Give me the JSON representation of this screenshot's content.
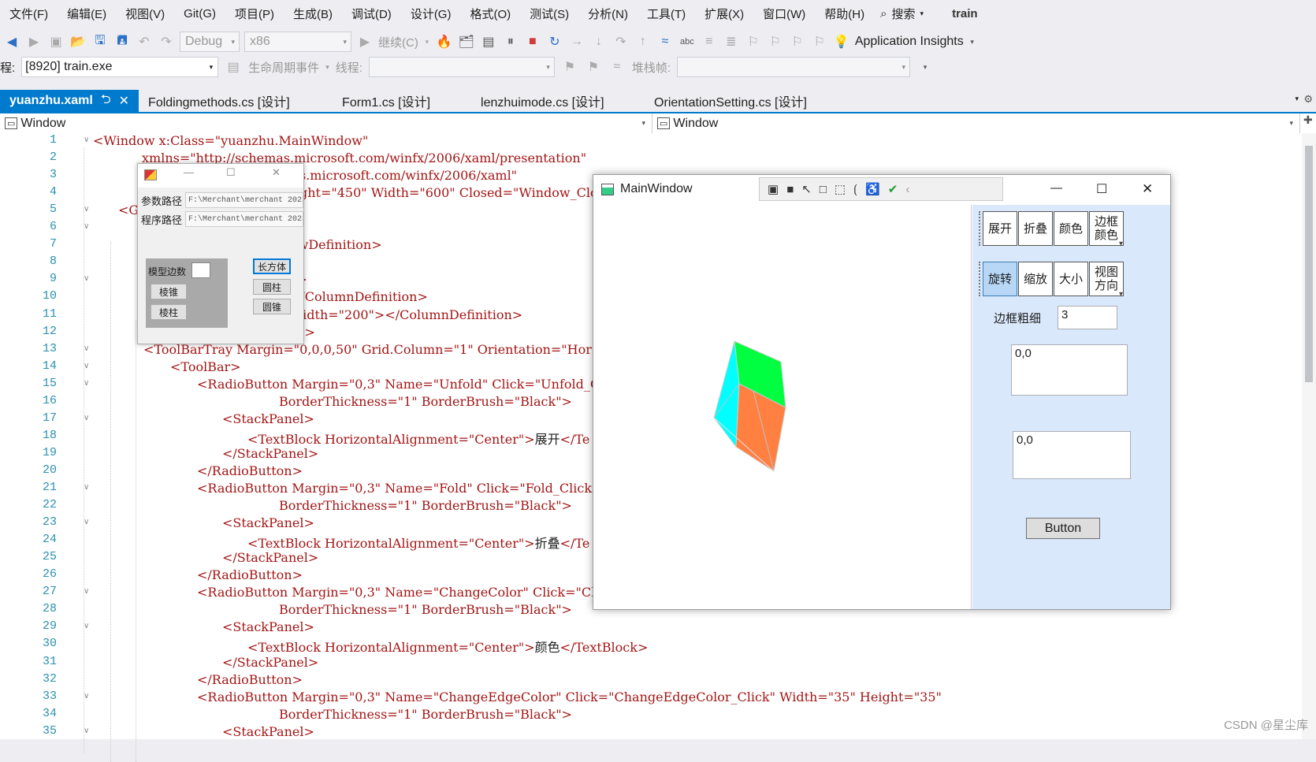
{
  "menu": [
    "文件(F)",
    "编辑(E)",
    "视图(V)",
    "Git(G)",
    "项目(P)",
    "生成(B)",
    "调试(D)",
    "设计(G)",
    "格式(O)",
    "测试(S)",
    "分析(N)",
    "工具(T)",
    "扩展(X)",
    "窗口(W)",
    "帮助(H)"
  ],
  "search_label": "搜索",
  "project_name": "train",
  "toolbar": {
    "config": "Debug",
    "platform": "x86",
    "continue_label": "继续(C)",
    "app_insights": "Application Insights"
  },
  "debug_bar": {
    "process_prefix": "程:",
    "process": "[8920] train.exe",
    "lifecycle": "生命周期事件",
    "thread_label": "线程:",
    "stack_label": "堆栈帧:"
  },
  "tabs": [
    {
      "label": "yuanzhu.xaml",
      "active": true
    },
    {
      "label": "Foldingmethods.cs [设计]",
      "active": false
    },
    {
      "label": "Form1.cs [设计]",
      "active": false
    },
    {
      "label": "lenzhuimode.cs [设计]",
      "active": false
    },
    {
      "label": "OrientationSetting.cs [设计]",
      "active": false
    }
  ],
  "nav": {
    "left": "Window",
    "right": "Window"
  },
  "line_numbers": [
    "1",
    "2",
    "3",
    "4",
    "5",
    "6",
    "7",
    "8",
    "9",
    "10",
    "11",
    "12",
    "13",
    "14",
    "15",
    "16",
    "17",
    "18",
    "19",
    "20",
    "21",
    "22",
    "23",
    "24",
    "25",
    "26",
    "27",
    "28",
    "29",
    "30",
    "31",
    "32",
    "33",
    "34",
    "35"
  ],
  "code": {
    "l1": "<Window x:Class=\"yuanzhu.MainWindow\"",
    "l2": "xmlns=\"http://schemas.microsoft.com/winfx/2006/xaml/presentation\"",
    "l3": "s.microsoft.com/winfx/2006/xaml\"",
    "l4": "ght=\"450\" Width=\"600\" Closed=\"Window_Clos",
    "l5": "<G",
    "l7": "owDefinition>",
    "l9": "s>",
    "l10": "</ColumnDefinition>",
    "l11": "Width=\"200\"></ColumnDefinition>",
    "l12": "ns>",
    "l13": "<ToolBarTray Margin=\"0,0,0,50\" Grid.Column=\"1\" Orientation=\"Hor",
    "l14": "<ToolBar>",
    "l15": "<RadioButton Margin=\"0,3\" Name=\"Unfold\" Click=\"Unfold_Cl",
    "l16": "BorderThickness=\"1\" BorderBrush=\"Black\">",
    "l17": "<StackPanel>",
    "l18a": "<TextBlock HorizontalAlignment=\"Center\">",
    "l18b": "展开",
    "l18c": "</Te",
    "l19": "</StackPanel>",
    "l20": "</RadioButton>",
    "l21": "<RadioButton Margin=\"0,3\" Name=\"Fold\" Click=\"Fold_Click\"",
    "l22": "BorderThickness=\"1\" BorderBrush=\"Black\">",
    "l23": "<StackPanel>",
    "l24a": "<TextBlock HorizontalAlignment=\"Center\">",
    "l24b": "折叠",
    "l24c": "</Te",
    "l25": "</StackPanel>",
    "l26": "</RadioButton>",
    "l27": "<RadioButton Margin=\"0,3\" Name=\"ChangeColor\" Click=\"Cha",
    "l28": "BorderThickness=\"1\" BorderBrush=\"Black\">",
    "l29": "<StackPanel>",
    "l30a": "<TextBlock HorizontalAlignment=\"Center\">",
    "l30b": "颜色",
    "l30c": "</TextBlock>",
    "l31": "</StackPanel>",
    "l32": "</RadioButton>",
    "l33": "<RadioButton Margin=\"0,3\" Name=\"ChangeEdgeColor\" Click=\"ChangeEdgeColor_Click\" Width=\"35\" Height=\"35\"",
    "l34": "BorderThickness=\"1\" BorderBrush=\"Black\">",
    "l35": "<StackPanel>"
  },
  "winform": {
    "param_label": "参数路径",
    "param_value": "F:\\Merchant\\merchant 2023",
    "program_label": "程序路径",
    "program_value": "F:\\Merchant\\merchant 2023",
    "edges_label": "模型边数",
    "btn_cone": "棱锥",
    "btn_prism": "棱柱",
    "btn_cuboid": "长方体",
    "btn_cylinder": "圆柱",
    "btn_circlecone": "圆锥"
  },
  "wpf": {
    "title": "MainWindow",
    "group1": [
      "展开",
      "折叠",
      "颜色",
      "边框颜色"
    ],
    "group2": [
      "旋转",
      "缩放",
      "大小",
      "视图方向"
    ],
    "border_label": "边框粗细",
    "border_value": "3",
    "text1": "0,0",
    "text2": "0,0",
    "button": "Button",
    "cube_colors": {
      "top": "#00ff40",
      "left": "#00ffff",
      "front": "#ff8040"
    }
  },
  "watermark": "CSDN @星尘库"
}
